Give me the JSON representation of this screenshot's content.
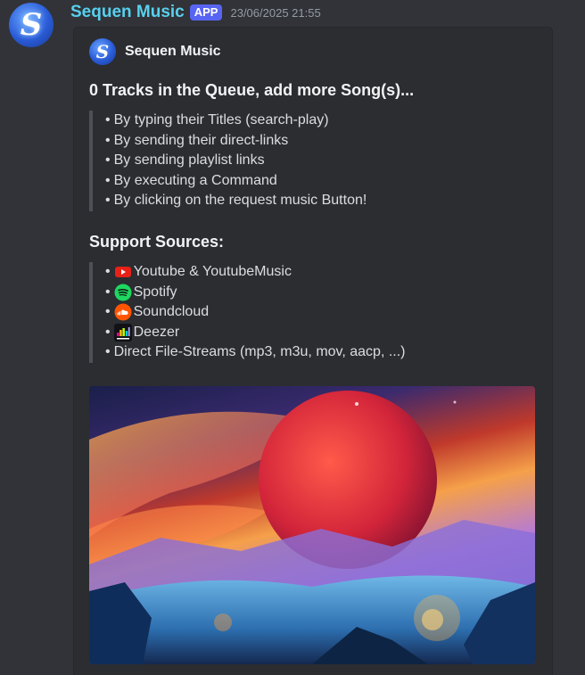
{
  "author": {
    "name": "Sequen Music",
    "badge": "APP",
    "timestamp": "23/06/2025 21:55"
  },
  "embed": {
    "author_name": "Sequen Music",
    "title": "0 Tracks in the Queue, add more Song(s)...",
    "add_methods": [
      "By typing their Titles (search-play)",
      "By sending their direct-links",
      "By sending playlist links",
      "By executing a Command",
      "By clicking on the request music Button!"
    ],
    "sources_title": "Support Sources:",
    "sources": [
      {
        "label": "Youtube & YoutubeMusic",
        "icon": "youtube-icon"
      },
      {
        "label": "Spotify",
        "icon": "spotify-icon"
      },
      {
        "label": "Soundcloud",
        "icon": "soundcloud-icon"
      },
      {
        "label": " Deezer",
        "icon": "deezer-icon"
      },
      {
        "label": "Direct File-Streams (mp3, m3u, mov, aacp, ...)",
        "icon": ""
      }
    ],
    "bullet": "•"
  },
  "colors": {
    "username": "#57d0ee",
    "badge": "#5865f2",
    "background": "#313338",
    "embed_background": "#2b2d31"
  }
}
